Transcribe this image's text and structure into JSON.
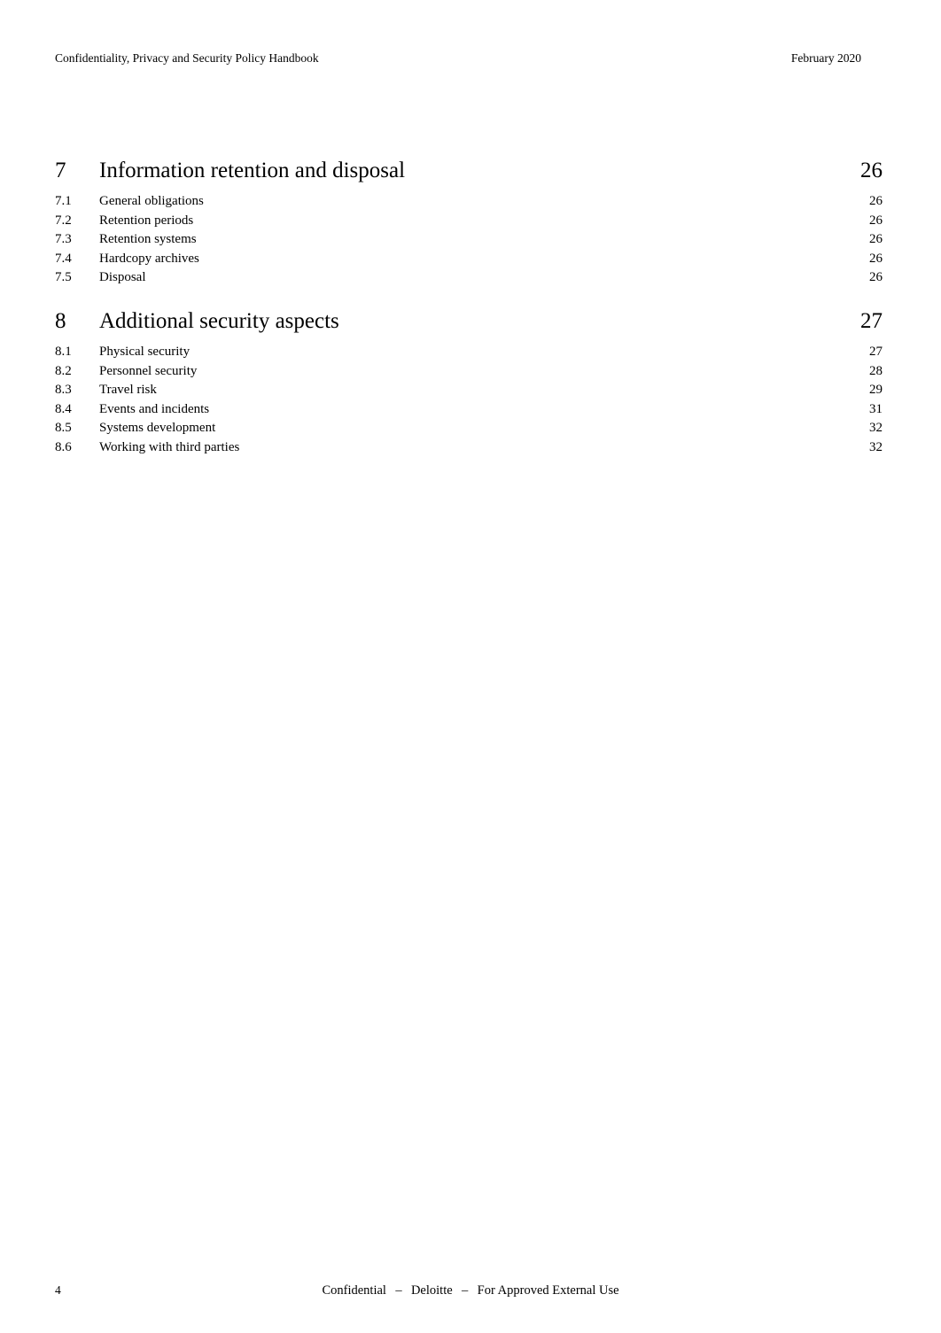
{
  "document": {
    "header": {
      "left_title": "Confidentiality, Privacy and Security Policy Handbook",
      "right_date": "February 2020"
    },
    "footer": {
      "page_number": "4",
      "classification": "Confidential",
      "separator_1": "–",
      "organization": "Deloitte",
      "separator_2": "–",
      "usage": "For Approved External Use"
    }
  },
  "toc": {
    "sections": [
      {
        "number": "7",
        "title": "Information retention and disposal",
        "page": "26",
        "entries": [
          {
            "number": "7.1",
            "title": "General obligations",
            "page": "26"
          },
          {
            "number": "7.2",
            "title": "Retention periods",
            "page": "26"
          },
          {
            "number": "7.3",
            "title": "Retention systems",
            "page": "26"
          },
          {
            "number": "7.4",
            "title": "Hardcopy archives",
            "page": "26"
          },
          {
            "number": "7.5",
            "title": "Disposal",
            "page": "26"
          }
        ]
      },
      {
        "number": "8",
        "title": "Additional security aspects",
        "page": "27",
        "entries": [
          {
            "number": "8.1",
            "title": "Physical security",
            "page": "27"
          },
          {
            "number": "8.2",
            "title": "Personnel security",
            "page": "28"
          },
          {
            "number": "8.3",
            "title": "Travel risk",
            "page": "29"
          },
          {
            "number": "8.4",
            "title": "Events and incidents",
            "page": "31"
          },
          {
            "number": "8.5",
            "title": "Systems development",
            "page": "32"
          },
          {
            "number": "8.6",
            "title": "Working with third parties",
            "page": "32"
          }
        ]
      }
    ]
  }
}
